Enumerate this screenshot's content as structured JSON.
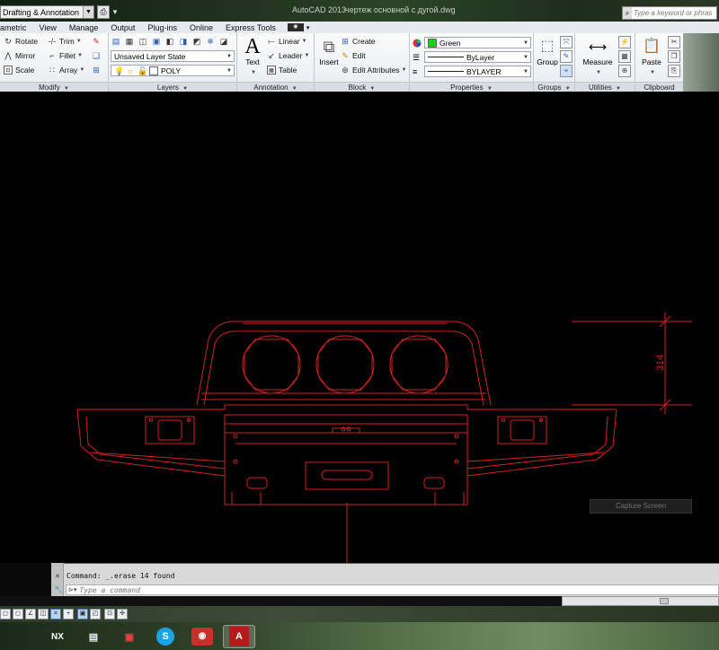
{
  "titlebar": {
    "workspace": "Drafting & Annotation",
    "app_title": "AutoCAD 2013",
    "file_title": "чертеж основной с дугой.dwg",
    "search_placeholder": "Type a keyword or phrase"
  },
  "tabs": [
    "Parametric",
    "View",
    "Manage",
    "Output",
    "Plug-ins",
    "Online",
    "Express Tools"
  ],
  "ribbon": {
    "modify": {
      "title": "Modify",
      "rotate": "Rotate",
      "trim": "Trim",
      "mirror": "Mirror",
      "fillet": "Fillet",
      "scale": "Scale",
      "array": "Array"
    },
    "layers": {
      "title": "Layers",
      "layer_state": "Unsaved Layer State",
      "current_layer": "POLY"
    },
    "annotation": {
      "title": "Annotation",
      "text": "Text",
      "linear": "Linear",
      "leader": "Leader",
      "table": "Table"
    },
    "block": {
      "title": "Block",
      "insert": "Insert",
      "create": "Create",
      "edit": "Edit",
      "edit_attributes": "Edit Attributes"
    },
    "properties": {
      "title": "Properties",
      "color": "Green",
      "color_hex": "#16d316",
      "linetype": "ByLayer",
      "lineweight": "BYLAYER"
    },
    "groups": {
      "title": "Groups",
      "group": "Group"
    },
    "utilities": {
      "title": "Utilities",
      "measure": "Measure"
    },
    "clipboard": {
      "title": "Clipboard",
      "paste": "Paste"
    }
  },
  "drawing": {
    "dimension_value": "314",
    "stroke_color": "#d42020",
    "capture_label": "Capture Screen"
  },
  "command": {
    "history": "Command: _.erase 14 found",
    "placeholder": "Type a command"
  },
  "taskbar": {
    "items": [
      "nx-icon",
      "notepad-icon",
      "utility-icon",
      "skype-icon",
      "camera-app-icon",
      "autocad-icon"
    ]
  }
}
